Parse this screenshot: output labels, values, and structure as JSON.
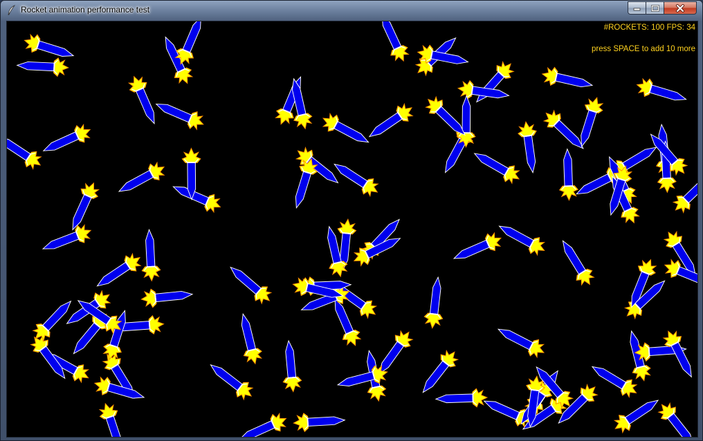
{
  "window": {
    "title": "Rocket animation performance test",
    "buttons": [
      "minimize-icon",
      "maximize-icon",
      "close-icon"
    ]
  },
  "hud": {
    "stats": "#ROCKETS: 100  FPS: 34",
    "hint": "press SPACE to add 10 more"
  },
  "scene": {
    "background": "#000000",
    "rocket_body_color": "#0000ee",
    "rocket_outline_color": "#ffffff",
    "flame_color": "#ffff00",
    "flame_outline_color": "#ff8c00",
    "rocket_count": 100
  }
}
